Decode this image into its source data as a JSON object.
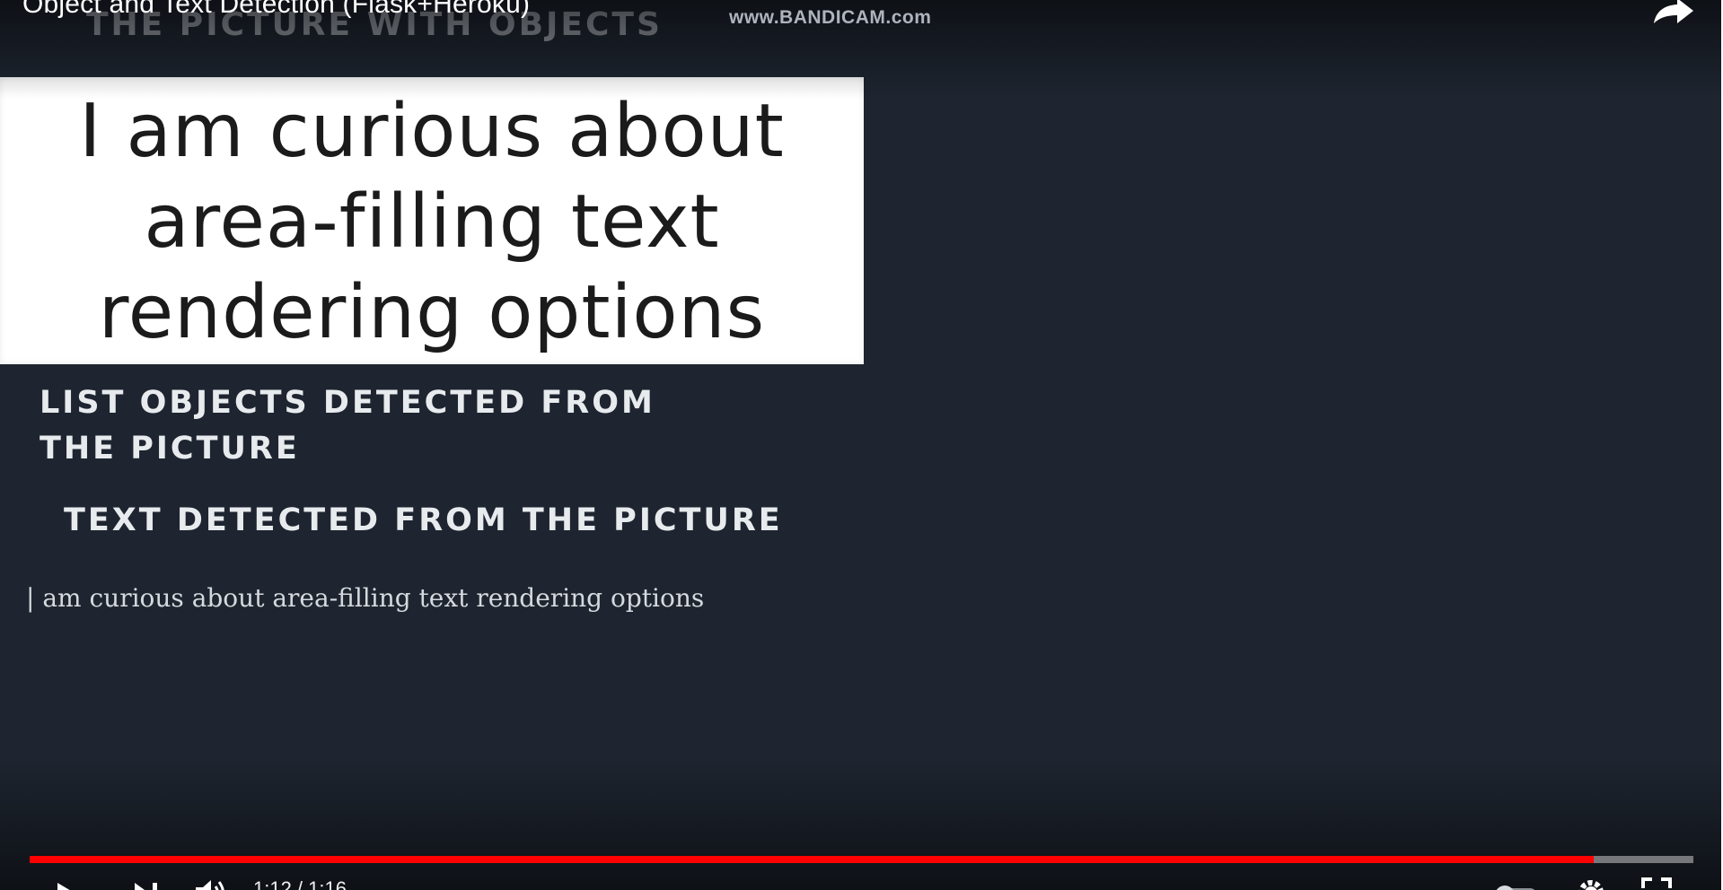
{
  "player": {
    "title": "Object and Text Detection (Flask+Heroku)",
    "watermark": "www.BANDICAM.com",
    "progress_fraction": 0.94,
    "time": "1:12 / 1:16",
    "chapter_marker": "··",
    "accent_color": "#ff0000",
    "icons": [
      "share-icon",
      "play-icon",
      "next-icon",
      "volume-icon",
      "autoplay-toggle-icon",
      "settings-icon",
      "fullscreen-icon"
    ]
  },
  "page": {
    "heading_picture": "THE PICTURE WITH OBJECTS",
    "image_lines": [
      "I am curious about",
      "area-filling text",
      "rendering options"
    ],
    "heading_objects": "LIST OBJECTS DETECTED FROM THE PICTURE",
    "heading_text": "TEXT DETECTED FROM THE PICTURE",
    "detected_text": "| am curious about area-filling text rendering options",
    "background_color": "#1e2530"
  }
}
